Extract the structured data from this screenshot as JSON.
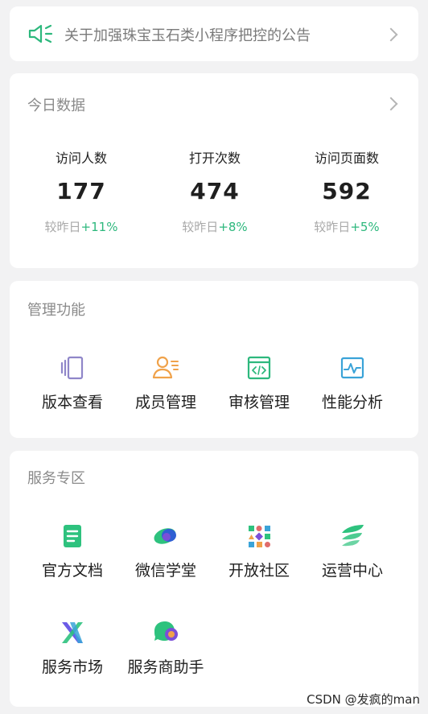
{
  "notice": {
    "text": "关于加强珠宝玉石类小程序把控的公告",
    "icon": "speaker-icon",
    "accent": "#2db87d"
  },
  "today": {
    "title": "今日数据",
    "stats": [
      {
        "label": "访问人数",
        "value": "177",
        "compare": "较昨日",
        "change": "+11%"
      },
      {
        "label": "打开次数",
        "value": "474",
        "compare": "较昨日",
        "change": "+8%"
      },
      {
        "label": "访问页面数",
        "value": "592",
        "compare": "较昨日",
        "change": "+5%"
      }
    ]
  },
  "management": {
    "title": "管理功能",
    "items": [
      {
        "label": "版本查看",
        "icon": "versions-icon",
        "color": "#8f86c9"
      },
      {
        "label": "成员管理",
        "icon": "member-icon",
        "color": "#f0a24a"
      },
      {
        "label": "审核管理",
        "icon": "code-review-icon",
        "color": "#2db87d"
      },
      {
        "label": "性能分析",
        "icon": "performance-icon",
        "color": "#3aa3d8"
      }
    ]
  },
  "service": {
    "title": "服务专区",
    "items": [
      {
        "label": "官方文档",
        "icon": "document-icon",
        "color": "#2ec27e"
      },
      {
        "label": "微信学堂",
        "icon": "school-icon",
        "color": "#2f5fd3"
      },
      {
        "label": "开放社区",
        "icon": "community-icon",
        "color": "#e06b6b"
      },
      {
        "label": "运营中心",
        "icon": "operations-icon",
        "color": "#2ec27e"
      },
      {
        "label": "服务市场",
        "icon": "market-icon",
        "color": "#6c5ce7"
      },
      {
        "label": "服务商助手",
        "icon": "assistant-icon",
        "color": "#2ec27e"
      }
    ]
  },
  "watermark": {
    "text": "CSDN @发疯的man"
  }
}
